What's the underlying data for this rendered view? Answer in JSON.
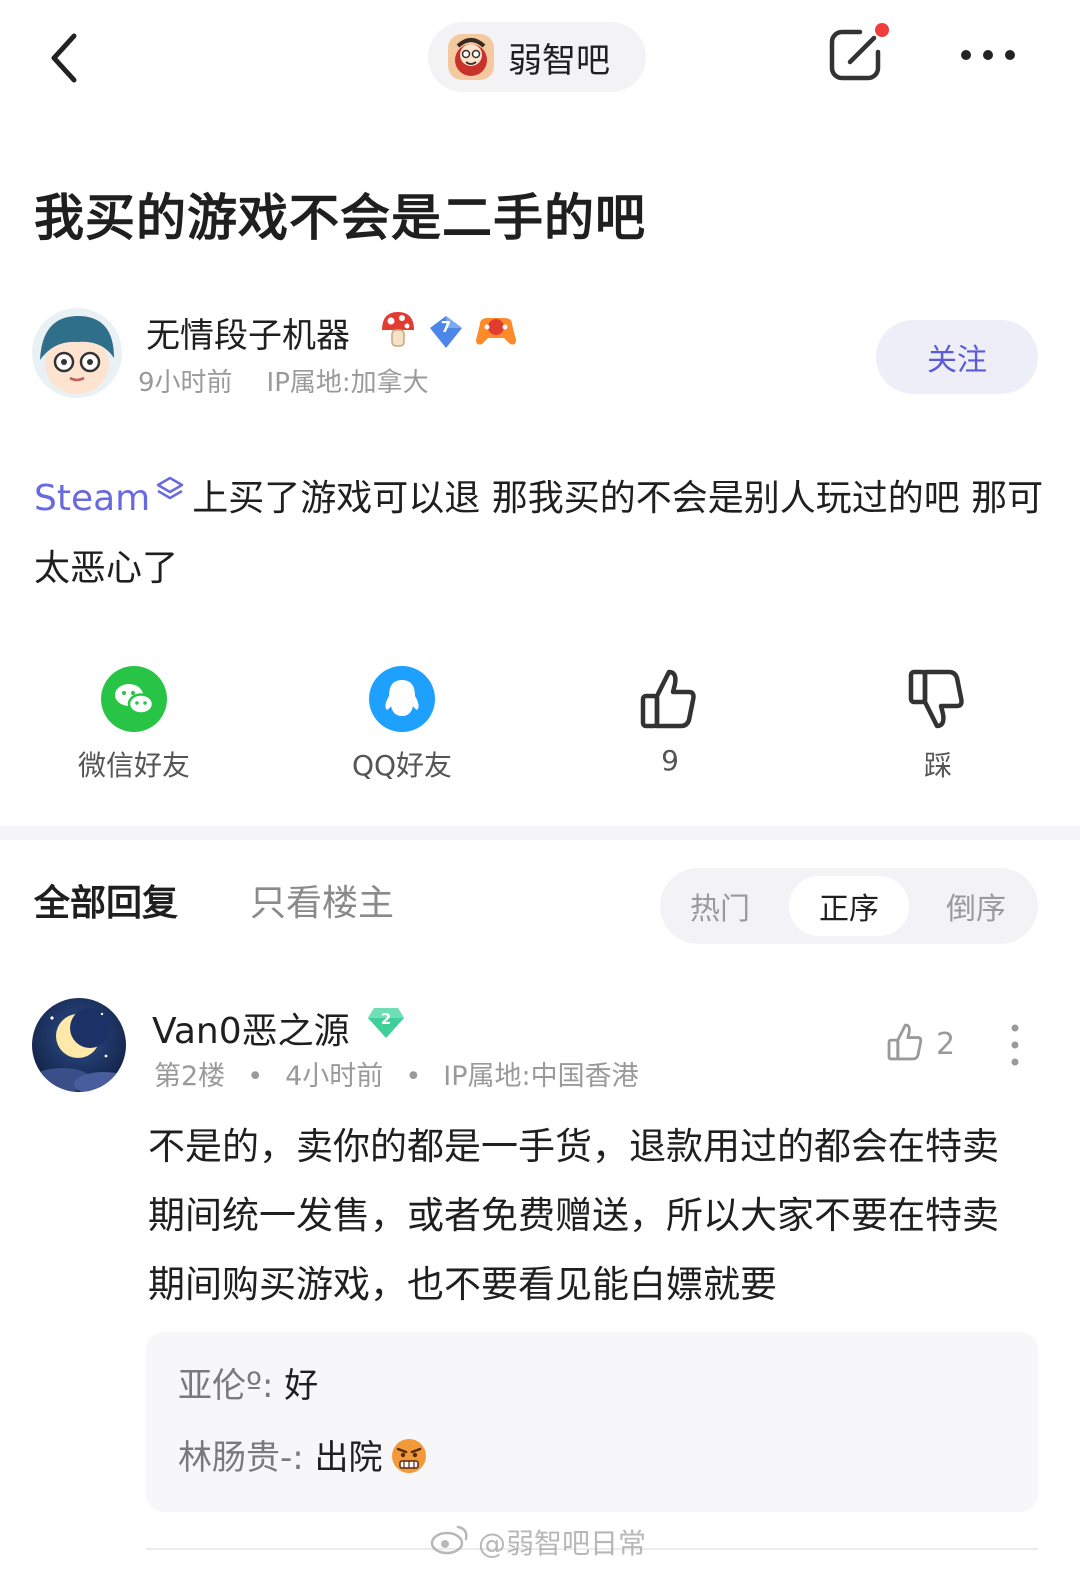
{
  "header": {
    "forum_name": "弱智吧",
    "icons": [
      "back-arrow-icon",
      "forum-logo",
      "edit-icon",
      "more-icon"
    ]
  },
  "post": {
    "title": "我买的游戏不会是二手的吧",
    "author": {
      "name": "无情段子机器",
      "level": "7",
      "time": "9小时前",
      "ip": "IP属地:加拿大",
      "follow_label": "关注"
    },
    "body": {
      "link_text": "Steam",
      "text": "上买了游戏可以退 那我买的不会是别人玩过的吧 那可太恶心了"
    }
  },
  "actions": {
    "wechat_label": "微信好友",
    "qq_label": "QQ好友",
    "like_count": "9",
    "dislike_label": "踩"
  },
  "reply_tabs": {
    "all_label": "全部回复",
    "op_only_label": "只看楼主",
    "sort_options": [
      "热门",
      "正序",
      "倒序"
    ],
    "active_sort": "正序"
  },
  "reply": {
    "name": "Van0恶之源",
    "level": "2",
    "floor": "第2楼",
    "time": "4小时前",
    "ip": "IP属地:中国香港",
    "like_count": "2",
    "text": "不是的，卖你的都是一手货，退款用过的都会在特卖期间统一发售，或者免费赠送，所以大家不要在特卖期间购买游戏，也不要看见能白嫖就要",
    "sub_replies": [
      {
        "user": "亚伦º:",
        "text": "好"
      },
      {
        "user": "林肠贵-:",
        "text": "出院"
      }
    ]
  },
  "watermark": "@弱智吧日常",
  "colors": {
    "accent": "#5b5bd6",
    "wechat": "#28c445",
    "qq": "#1ea0ff",
    "follow_bg": "#eeeef8",
    "notification_dot": "#f23d3d"
  }
}
